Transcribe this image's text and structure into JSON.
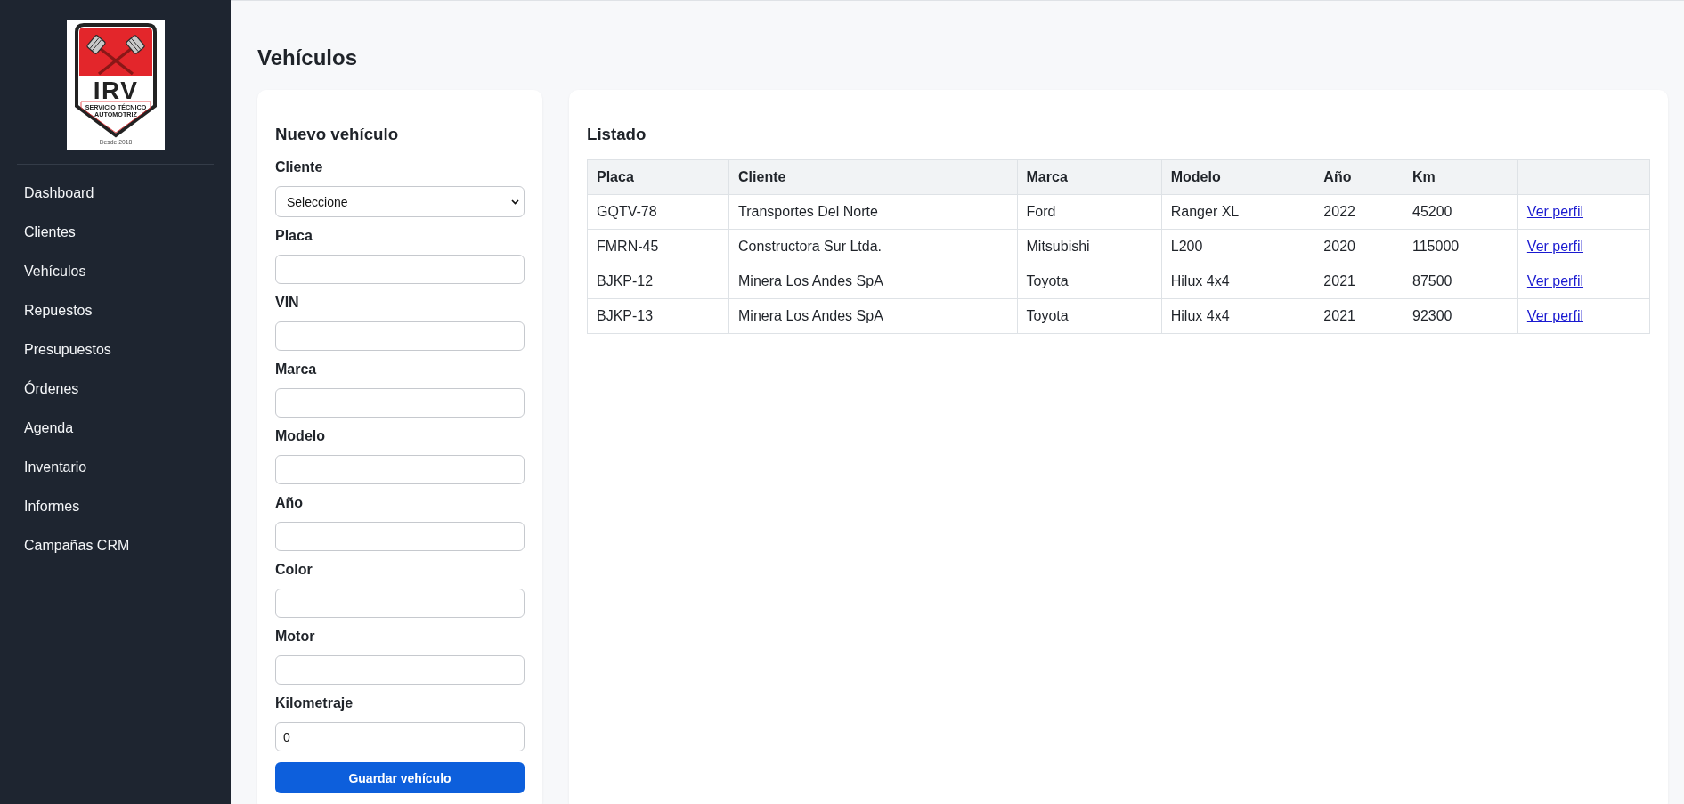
{
  "sidebar": {
    "logo": {
      "title": "IRV",
      "tagline": [
        "SERVICIO TÉCNICO",
        "AUTOMOTRIZ"
      ],
      "since": "Desde 2018"
    },
    "items": [
      "Dashboard",
      "Clientes",
      "Vehículos",
      "Repuestos",
      "Presupuestos",
      "Órdenes",
      "Agenda",
      "Inventario",
      "Informes",
      "Campañas CRM"
    ]
  },
  "page": {
    "title": "Vehículos"
  },
  "form": {
    "title": "Nuevo vehículo",
    "fields": [
      {
        "kind": "select",
        "label": "Cliente",
        "value": "Seleccione"
      },
      {
        "kind": "text",
        "label": "Placa"
      },
      {
        "kind": "text",
        "label": "VIN"
      },
      {
        "kind": "text",
        "label": "Marca"
      },
      {
        "kind": "text",
        "label": "Modelo"
      },
      {
        "kind": "text",
        "label": "Año"
      },
      {
        "kind": "text",
        "label": "Color"
      },
      {
        "kind": "text",
        "label": "Motor"
      },
      {
        "kind": "text",
        "label": "Kilometraje",
        "value": "0"
      }
    ],
    "submit": "Guardar vehículo"
  },
  "listing": {
    "title": "Listado",
    "table": {
      "columns": [
        "Placa",
        "Cliente",
        "Marca",
        "Modelo",
        "Año",
        "Km"
      ],
      "rows": [
        {
          "cells": [
            "GQTV-78",
            "Transportes Del Norte",
            "Ford",
            "Ranger XL",
            "2022",
            "45200"
          ],
          "action": "Ver perfil"
        },
        {
          "cells": [
            "FMRN-45",
            "Constructora Sur Ltda.",
            "Mitsubishi",
            "L200",
            "2020",
            "115000"
          ],
          "action": "Ver perfil"
        },
        {
          "cells": [
            "BJKP-12",
            "Minera Los Andes SpA",
            "Toyota",
            "Hilux 4x4",
            "2021",
            "87500"
          ],
          "action": "Ver perfil"
        },
        {
          "cells": [
            "BJKP-13",
            "Minera Los Andes SpA",
            "Toyota",
            "Hilux 4x4",
            "2021",
            "92300"
          ],
          "action": "Ver perfil"
        }
      ]
    }
  }
}
